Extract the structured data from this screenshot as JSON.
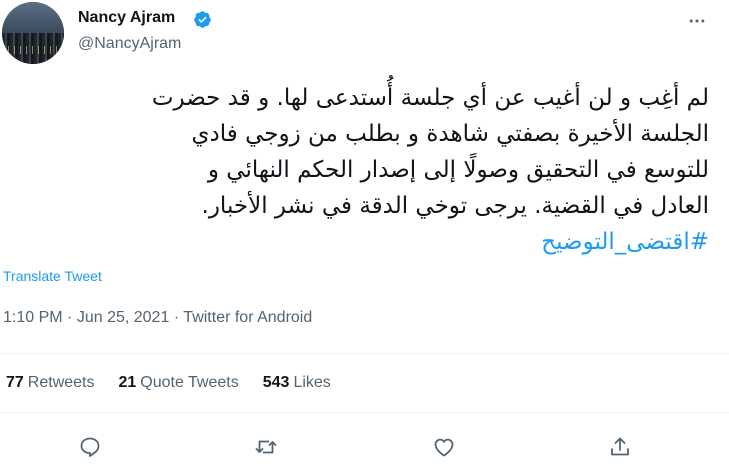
{
  "author": {
    "display_name": "Nancy Ajram",
    "handle": "@NancyAjram",
    "verified": true
  },
  "tweet": {
    "text": "لم أغِب و لن أغيب عن أي جلسة أُستدعى لها. و قد حضرت\nالجلسة الأخيرة بصفتي شاهدة و بطلب من زوجي فادي\nللتوسع في التحقيق وصولًا إلى إصدار الحكم النهائي و\nالعادل في القضية. يرجى توخي الدقة في نشر الأخبار.",
    "hashtag": "#اقتضى_التوضيح",
    "translate_label": "Translate Tweet",
    "time": "1:10 PM",
    "date": "Jun 25, 2021",
    "source": "Twitter for Android"
  },
  "stats": {
    "retweets": {
      "count": "77",
      "label": "Retweets"
    },
    "quote_tweets": {
      "count": "21",
      "label": "Quote Tweets"
    },
    "likes": {
      "count": "543",
      "label": "Likes"
    }
  },
  "icons": {
    "more": "more-horizontal-icon",
    "reply": "reply-icon",
    "retweet": "retweet-icon",
    "like": "heart-icon",
    "share": "share-icon",
    "verified": "verified-badge-icon"
  },
  "colors": {
    "accent": "#1d9bf0",
    "text_primary": "#0f1419",
    "text_secondary": "#536471",
    "divider": "#eff3f4"
  }
}
